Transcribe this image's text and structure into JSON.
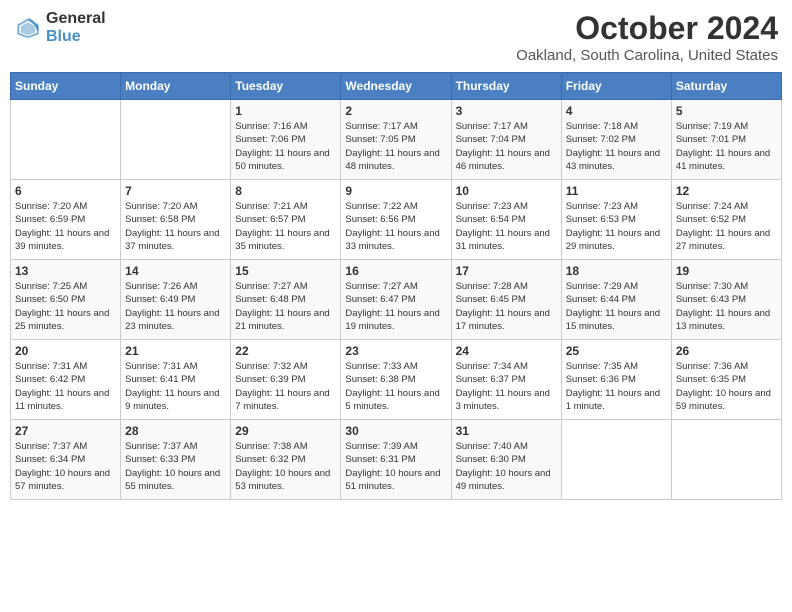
{
  "logo": {
    "text_general": "General",
    "text_blue": "Blue"
  },
  "title": "October 2024",
  "subtitle": "Oakland, South Carolina, United States",
  "days_of_week": [
    "Sunday",
    "Monday",
    "Tuesday",
    "Wednesday",
    "Thursday",
    "Friday",
    "Saturday"
  ],
  "weeks": [
    [
      {
        "day": "",
        "info": ""
      },
      {
        "day": "",
        "info": ""
      },
      {
        "day": "1",
        "info": "Sunrise: 7:16 AM\nSunset: 7:06 PM\nDaylight: 11 hours and 50 minutes."
      },
      {
        "day": "2",
        "info": "Sunrise: 7:17 AM\nSunset: 7:05 PM\nDaylight: 11 hours and 48 minutes."
      },
      {
        "day": "3",
        "info": "Sunrise: 7:17 AM\nSunset: 7:04 PM\nDaylight: 11 hours and 46 minutes."
      },
      {
        "day": "4",
        "info": "Sunrise: 7:18 AM\nSunset: 7:02 PM\nDaylight: 11 hours and 43 minutes."
      },
      {
        "day": "5",
        "info": "Sunrise: 7:19 AM\nSunset: 7:01 PM\nDaylight: 11 hours and 41 minutes."
      }
    ],
    [
      {
        "day": "6",
        "info": "Sunrise: 7:20 AM\nSunset: 6:59 PM\nDaylight: 11 hours and 39 minutes."
      },
      {
        "day": "7",
        "info": "Sunrise: 7:20 AM\nSunset: 6:58 PM\nDaylight: 11 hours and 37 minutes."
      },
      {
        "day": "8",
        "info": "Sunrise: 7:21 AM\nSunset: 6:57 PM\nDaylight: 11 hours and 35 minutes."
      },
      {
        "day": "9",
        "info": "Sunrise: 7:22 AM\nSunset: 6:56 PM\nDaylight: 11 hours and 33 minutes."
      },
      {
        "day": "10",
        "info": "Sunrise: 7:23 AM\nSunset: 6:54 PM\nDaylight: 11 hours and 31 minutes."
      },
      {
        "day": "11",
        "info": "Sunrise: 7:23 AM\nSunset: 6:53 PM\nDaylight: 11 hours and 29 minutes."
      },
      {
        "day": "12",
        "info": "Sunrise: 7:24 AM\nSunset: 6:52 PM\nDaylight: 11 hours and 27 minutes."
      }
    ],
    [
      {
        "day": "13",
        "info": "Sunrise: 7:25 AM\nSunset: 6:50 PM\nDaylight: 11 hours and 25 minutes."
      },
      {
        "day": "14",
        "info": "Sunrise: 7:26 AM\nSunset: 6:49 PM\nDaylight: 11 hours and 23 minutes."
      },
      {
        "day": "15",
        "info": "Sunrise: 7:27 AM\nSunset: 6:48 PM\nDaylight: 11 hours and 21 minutes."
      },
      {
        "day": "16",
        "info": "Sunrise: 7:27 AM\nSunset: 6:47 PM\nDaylight: 11 hours and 19 minutes."
      },
      {
        "day": "17",
        "info": "Sunrise: 7:28 AM\nSunset: 6:45 PM\nDaylight: 11 hours and 17 minutes."
      },
      {
        "day": "18",
        "info": "Sunrise: 7:29 AM\nSunset: 6:44 PM\nDaylight: 11 hours and 15 minutes."
      },
      {
        "day": "19",
        "info": "Sunrise: 7:30 AM\nSunset: 6:43 PM\nDaylight: 11 hours and 13 minutes."
      }
    ],
    [
      {
        "day": "20",
        "info": "Sunrise: 7:31 AM\nSunset: 6:42 PM\nDaylight: 11 hours and 11 minutes."
      },
      {
        "day": "21",
        "info": "Sunrise: 7:31 AM\nSunset: 6:41 PM\nDaylight: 11 hours and 9 minutes."
      },
      {
        "day": "22",
        "info": "Sunrise: 7:32 AM\nSunset: 6:39 PM\nDaylight: 11 hours and 7 minutes."
      },
      {
        "day": "23",
        "info": "Sunrise: 7:33 AM\nSunset: 6:38 PM\nDaylight: 11 hours and 5 minutes."
      },
      {
        "day": "24",
        "info": "Sunrise: 7:34 AM\nSunset: 6:37 PM\nDaylight: 11 hours and 3 minutes."
      },
      {
        "day": "25",
        "info": "Sunrise: 7:35 AM\nSunset: 6:36 PM\nDaylight: 11 hours and 1 minute."
      },
      {
        "day": "26",
        "info": "Sunrise: 7:36 AM\nSunset: 6:35 PM\nDaylight: 10 hours and 59 minutes."
      }
    ],
    [
      {
        "day": "27",
        "info": "Sunrise: 7:37 AM\nSunset: 6:34 PM\nDaylight: 10 hours and 57 minutes."
      },
      {
        "day": "28",
        "info": "Sunrise: 7:37 AM\nSunset: 6:33 PM\nDaylight: 10 hours and 55 minutes."
      },
      {
        "day": "29",
        "info": "Sunrise: 7:38 AM\nSunset: 6:32 PM\nDaylight: 10 hours and 53 minutes."
      },
      {
        "day": "30",
        "info": "Sunrise: 7:39 AM\nSunset: 6:31 PM\nDaylight: 10 hours and 51 minutes."
      },
      {
        "day": "31",
        "info": "Sunrise: 7:40 AM\nSunset: 6:30 PM\nDaylight: 10 hours and 49 minutes."
      },
      {
        "day": "",
        "info": ""
      },
      {
        "day": "",
        "info": ""
      }
    ]
  ]
}
